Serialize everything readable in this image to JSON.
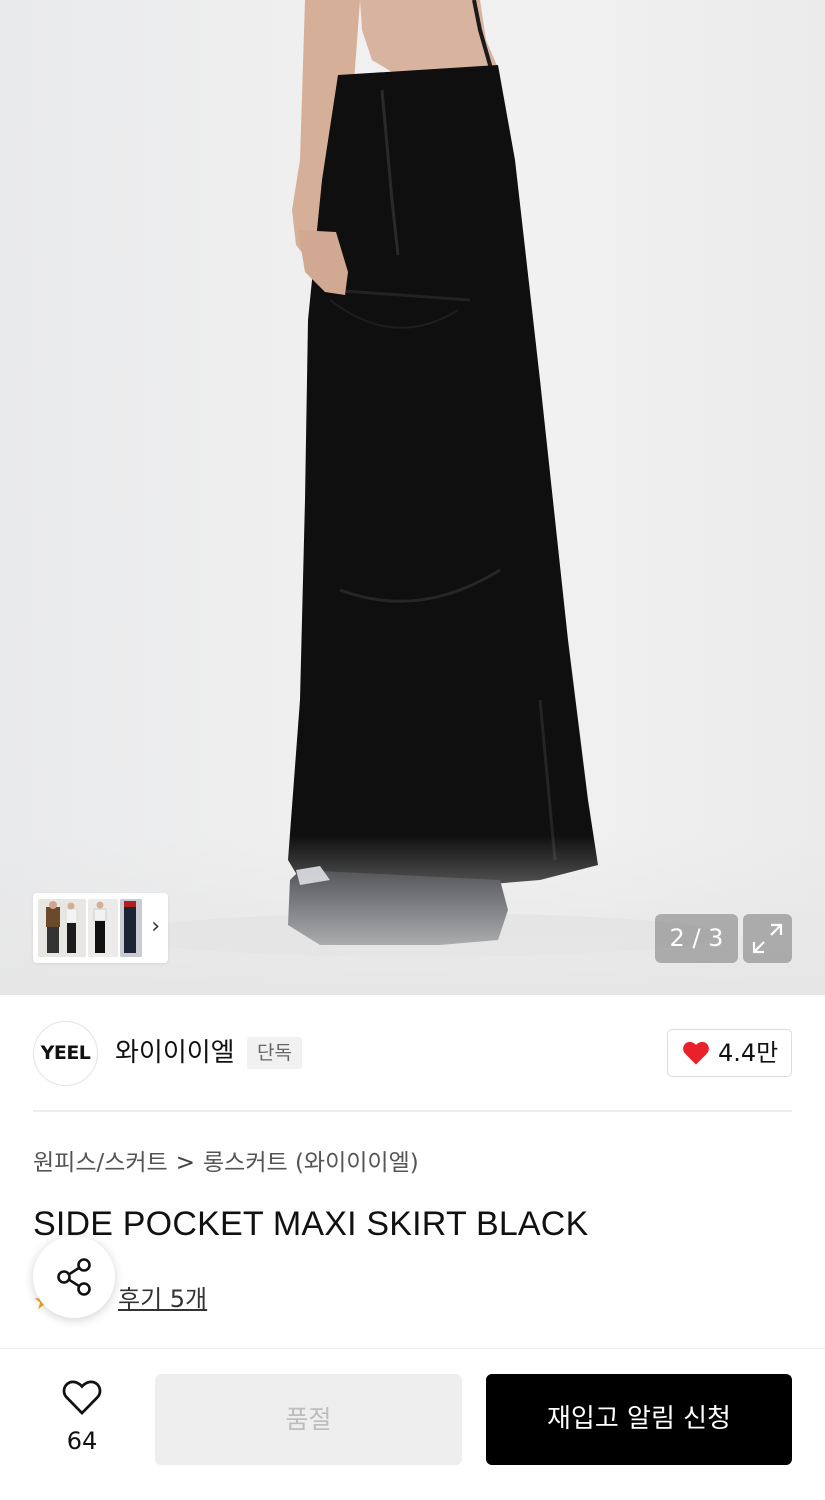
{
  "gallery": {
    "counter": "2 / 3",
    "current_index": 2,
    "total": 3
  },
  "brand": {
    "logo_text": "YEEL",
    "name": "와이이이엘",
    "badge": "단독",
    "likes": "4.4만"
  },
  "product": {
    "breadcrumb": [
      "원피스/스커트",
      "롱스커트 (와이이이엘)"
    ],
    "breadcrumb_sep": ">",
    "title": "SIDE POCKET MAXI SKIRT BLACK",
    "review_label": "후기 5개"
  },
  "bottom_bar": {
    "wish_count": "64",
    "soldout_label": "품절",
    "restock_label": "재입고 알림 신청"
  },
  "colors": {
    "heart": "#e8212b",
    "primary_button": "#000000",
    "disabled_button": "#eeeeee",
    "star": "#f5a623"
  },
  "icons": [
    "chevron-right-icon",
    "expand-icon",
    "heart-icon",
    "share-icon",
    "star-icon",
    "heart-outline-icon"
  ]
}
